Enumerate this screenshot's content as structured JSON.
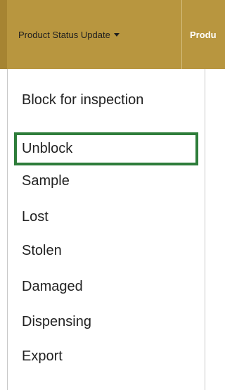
{
  "navbar": {
    "status_menu_label": "Product Status Update",
    "next_menu_label": "Produ"
  },
  "dropdown": {
    "items": [
      "Block for inspection",
      "Unblock",
      "Sample",
      "Lost",
      "Stolen",
      "Damaged",
      "Dispensing",
      "Export"
    ],
    "highlighted_item": "Unblock"
  },
  "colors": {
    "navbar_bg": "#b8963f",
    "highlight_border": "#2e7d3a",
    "menu_bg": "#ffffff"
  }
}
